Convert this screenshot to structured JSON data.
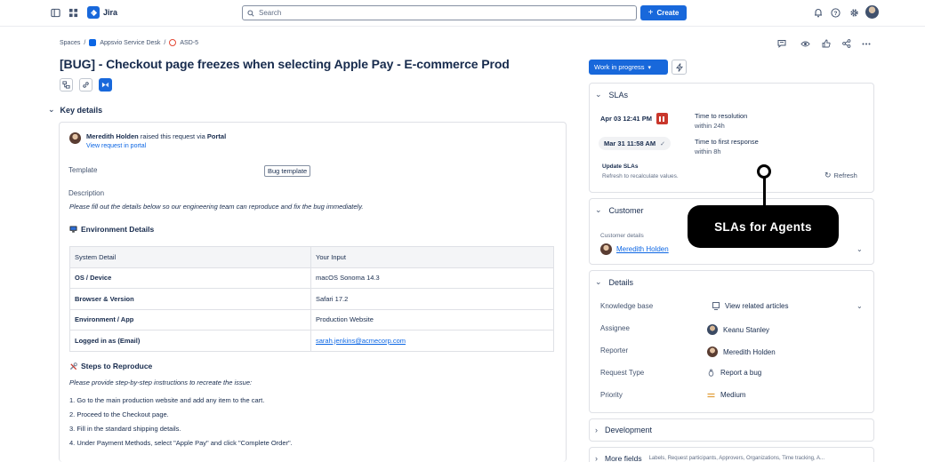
{
  "topbar": {
    "product_name": "Jira",
    "search_placeholder": "Search",
    "create_label": "Create"
  },
  "breadcrumb": {
    "root": "Spaces",
    "project": "Appsvio Service Desk",
    "issue_key": "ASD-5",
    "sep": "/"
  },
  "issue": {
    "title": "[BUG] - Checkout page freezes when selecting Apple Pay - E-commerce Prod",
    "key_details_label": "Key details"
  },
  "request": {
    "requester": "Meredith Holden",
    "raised_text": "raised this request via",
    "channel": "Portal",
    "view_link": "View request in portal",
    "template_label": "Template",
    "template_value": "Bug template",
    "description_label": "Description",
    "description_text": "Please fill out the details below so our engineering team can reproduce and fix the bug immediately.",
    "env_heading": "Environment Details",
    "env_table": {
      "headers": [
        "System Detail",
        "Your Input"
      ],
      "rows": [
        [
          "OS / Device",
          "macOS Sonoma 14.3"
        ],
        [
          "Browser & Version",
          "Safari 17.2"
        ],
        [
          "Environment / App",
          "Production Website"
        ],
        [
          "Logged in as (Email)",
          "sarah.jenkins@acmecorp.com"
        ]
      ]
    },
    "steps_heading": "Steps to Reproduce",
    "steps_intro": "Please provide step-by-step instructions to recreate the issue:",
    "steps": [
      "1. Go to the main production website and add any item to the cart.",
      "2. Proceed to the Checkout page.",
      "3. Fill in the standard shipping details.",
      "4. Under Payment Methods, select \"Apple Pay\" and click \"Complete Order\"."
    ]
  },
  "sidebar": {
    "status": "Work in progress",
    "slas": {
      "title": "SLAs",
      "items": [
        {
          "date": "Apr 03 12:41 PM",
          "name": "Time to resolution",
          "target": "within 24h"
        },
        {
          "date": "Mar 31 11:58 AM",
          "name": "Time to first response",
          "target": "within 8h"
        }
      ],
      "update_label": "Update SLAs",
      "update_sub": "Refresh to recalculate values.",
      "refresh_label": "Refresh"
    },
    "customer": {
      "title": "Customer",
      "sub": "Customer details",
      "name": "Meredith Holden"
    },
    "details": {
      "title": "Details",
      "rows": [
        {
          "label": "Knowledge base",
          "value": "View related articles"
        },
        {
          "label": "Assignee",
          "value": "Keanu Stanley"
        },
        {
          "label": "Reporter",
          "value": "Meredith Holden"
        },
        {
          "label": "Request Type",
          "value": "Report a bug"
        },
        {
          "label": "Priority",
          "value": "Medium"
        }
      ]
    },
    "development": {
      "title": "Development"
    },
    "more_fields": {
      "title": "More fields",
      "summary": "Labels, Request participants, Approvers, Organizations, Time tracking, A..."
    }
  },
  "callout": {
    "text": "SLAs for Agents"
  },
  "colors": {
    "brand_blue": "#1868db",
    "pause_red": "#c9372c",
    "callout_bg": "#000000"
  }
}
